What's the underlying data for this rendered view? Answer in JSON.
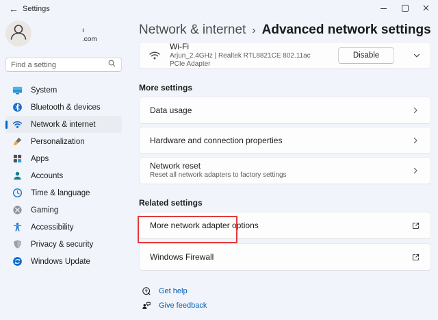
{
  "titlebar": {
    "title": "Settings",
    "back_glyph": "←",
    "close_glyph": "×"
  },
  "user": {
    "name_fragment": "ı",
    "email_fragment": ".com"
  },
  "search": {
    "placeholder": "Find a setting",
    "value": ""
  },
  "sidebar": {
    "items": [
      {
        "label": "System",
        "icon": "system-icon",
        "selected": false
      },
      {
        "label": "Bluetooth & devices",
        "icon": "bluetooth-icon",
        "selected": false
      },
      {
        "label": "Network & internet",
        "icon": "wifi-icon",
        "selected": true
      },
      {
        "label": "Personalization",
        "icon": "brush-icon",
        "selected": false
      },
      {
        "label": "Apps",
        "icon": "apps-grid-icon",
        "selected": false
      },
      {
        "label": "Accounts",
        "icon": "person-icon",
        "selected": false
      },
      {
        "label": "Time & language",
        "icon": "clock-icon",
        "selected": false
      },
      {
        "label": "Gaming",
        "icon": "xbox-icon",
        "selected": false
      },
      {
        "label": "Accessibility",
        "icon": "accessibility-person-icon",
        "selected": false
      },
      {
        "label": "Privacy & security",
        "icon": "shield-icon",
        "selected": false
      },
      {
        "label": "Windows Update",
        "icon": "update-arrows-icon",
        "selected": false
      }
    ]
  },
  "main": {
    "breadcrumb": {
      "parent": "Network & internet",
      "separator": "›",
      "current": "Advanced network settings"
    },
    "wifi_card": {
      "title": "Wi-Fi",
      "subtitle": "Arjun_2.4GHz | Realtek RTL8821CE 802.11ac PCIe Adapter",
      "button_label": "Disable"
    },
    "more_settings": {
      "heading": "More settings",
      "items": [
        {
          "title": "Data usage",
          "subtitle": ""
        },
        {
          "title": "Hardware and connection properties",
          "subtitle": ""
        },
        {
          "title": "Network reset",
          "subtitle": "Reset all network adapters to factory settings"
        }
      ]
    },
    "related_settings": {
      "heading": "Related settings",
      "items": [
        {
          "title": "More network adapter options",
          "highlighted": true
        },
        {
          "title": "Windows Firewall",
          "highlighted": false
        }
      ]
    },
    "footer_links": [
      {
        "label": "Get help",
        "icon": "help-question-icon"
      },
      {
        "label": "Give feedback",
        "icon": "feedback-person-icon"
      }
    ]
  },
  "colors": {
    "accent": "#0067c0",
    "link": "#005fb8",
    "annotation_red": "#e23a3a",
    "background": "#f1f4fb",
    "card_background": "#fdfdfd"
  }
}
